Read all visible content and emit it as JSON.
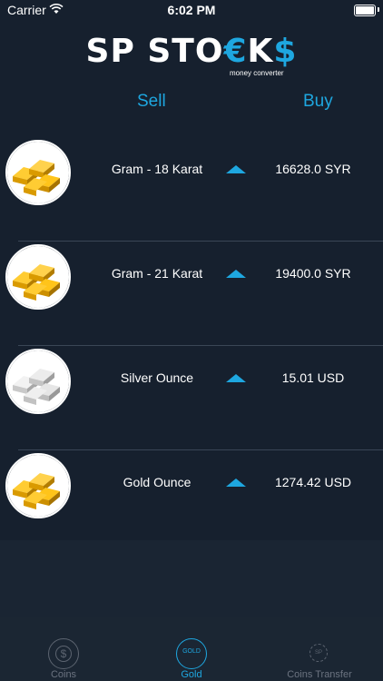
{
  "status_bar": {
    "carrier": "Carrier",
    "time": "6:02 PM"
  },
  "logo": {
    "title_part1": "SP STO",
    "title_accent1": "€",
    "title_part2": "K",
    "title_accent2": "$",
    "subtitle": "money converter"
  },
  "columns": {
    "sell": "Sell",
    "buy": "Buy"
  },
  "items": [
    {
      "name": "Gram - 18 Karat",
      "price": "16628.0 SYR",
      "metal": "gold"
    },
    {
      "name": "Gram - 21 Karat",
      "price": "19400.0 SYR",
      "metal": "gold"
    },
    {
      "name": "Silver Ounce",
      "price": "15.01 USD",
      "metal": "silver"
    },
    {
      "name": "Gold Ounce",
      "price": "1274.42 USD",
      "metal": "gold"
    }
  ],
  "tabs": [
    {
      "label": "Coins",
      "icon": "dollar-coin-icon",
      "active": false,
      "icon_text": "$"
    },
    {
      "label": "Gold",
      "icon": "gold-icon",
      "active": true,
      "icon_text": "GOLD"
    },
    {
      "label": "Coins Transfer",
      "icon": "transfer-icon",
      "active": false,
      "icon_text": "SP"
    }
  ],
  "colors": {
    "accent": "#1ea7e0",
    "background": "#16202e",
    "inactive": "#6b7380"
  }
}
